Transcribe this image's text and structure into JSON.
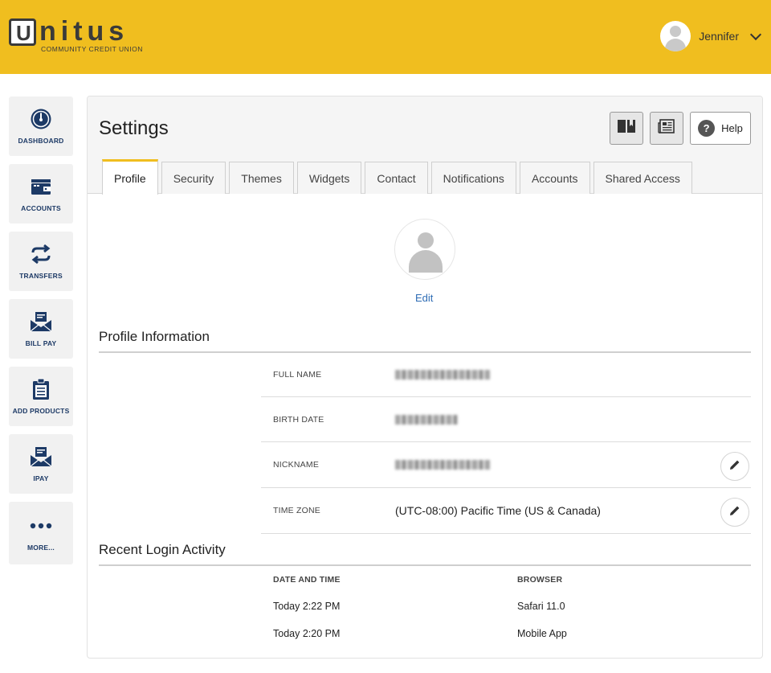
{
  "brand": {
    "name": "nitus",
    "letter": "U",
    "subtitle": "COMMUNITY CREDIT UNION",
    "accent": "#f0be1f",
    "navy": "#1d3a66"
  },
  "user": {
    "name": "Jennifer",
    "avatar_icon": "user-avatar-icon",
    "menu_icon": "chevron-down-icon"
  },
  "nav": [
    {
      "label": "DASHBOARD",
      "icon": "gauge-icon"
    },
    {
      "label": "ACCOUNTS",
      "icon": "wallet-icon"
    },
    {
      "label": "TRANSFERS",
      "icon": "transfer-arrows-icon"
    },
    {
      "label": "BILL PAY",
      "icon": "envelope-icon"
    },
    {
      "label": "ADD PRODUCTS",
      "icon": "clipboard-icon"
    },
    {
      "label": "IPAY",
      "icon": "envelope-icon"
    },
    {
      "label": "MORE...",
      "icon": "more-dots-icon"
    }
  ],
  "page": {
    "title": "Settings",
    "help_label": "Help",
    "tabs": [
      "Profile",
      "Security",
      "Themes",
      "Widgets",
      "Contact",
      "Notifications",
      "Accounts",
      "Shared Access"
    ],
    "active_tab": "Profile",
    "edit_label": "Edit"
  },
  "profile": {
    "section_title": "Profile Information",
    "fields": [
      {
        "label": "FULL NAME",
        "value": "",
        "redacted": true
      },
      {
        "label": "BIRTH DATE",
        "value": "",
        "redacted": true
      },
      {
        "label": "NICKNAME",
        "value": "",
        "redacted": true,
        "editable": true
      },
      {
        "label": "TIME ZONE",
        "value": "(UTC-08:00) Pacific Time (US & Canada)",
        "editable": true
      }
    ]
  },
  "logins": {
    "section_title": "Recent Login Activity",
    "headers": {
      "date": "DATE AND TIME",
      "browser": "BROWSER"
    },
    "rows": [
      {
        "date": "Today 2:22 PM",
        "browser": "Safari 11.0"
      },
      {
        "date": "Today 2:20 PM",
        "browser": "Mobile App"
      }
    ]
  }
}
